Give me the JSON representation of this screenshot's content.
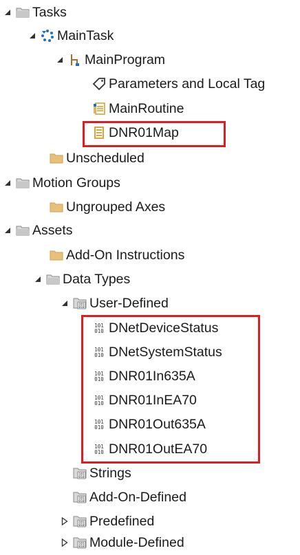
{
  "tree": {
    "tasks": {
      "label": "Tasks",
      "icon": "folder-open-icon"
    },
    "main_task": {
      "label": "MainTask",
      "icon": "continuous-task-icon"
    },
    "main_program": {
      "label": "MainProgram",
      "icon": "program-icon"
    },
    "parameters": {
      "label": "Parameters and Local Tag",
      "icon": "tag-icon"
    },
    "main_routine": {
      "label": "MainRoutine",
      "icon": "ladder-routine-icon"
    },
    "dnr01map": {
      "label": "DNR01Map",
      "icon": "routine-icon"
    },
    "unscheduled": {
      "label": "Unscheduled",
      "icon": "folder-icon"
    },
    "motion_groups": {
      "label": "Motion Groups",
      "icon": "folder-open-icon"
    },
    "ungrouped_axes": {
      "label": "Ungrouped Axes",
      "icon": "folder-icon"
    },
    "assets": {
      "label": "Assets",
      "icon": "folder-open-icon"
    },
    "add_on_instructions": {
      "label": "Add-On Instructions",
      "icon": "folder-icon"
    },
    "data_types": {
      "label": "Data Types",
      "icon": "folder-open-icon"
    },
    "user_defined": {
      "label": "User-Defined",
      "icon": "datatype-folder-icon"
    },
    "udts": [
      {
        "label": "DNetDeviceStatus",
        "icon": "binary-datatype-icon"
      },
      {
        "label": "DNetSystemStatus",
        "icon": "binary-datatype-icon"
      },
      {
        "label": "DNR01In635A",
        "icon": "binary-datatype-icon"
      },
      {
        "label": "DNR01InEA70",
        "icon": "binary-datatype-icon"
      },
      {
        "label": "DNR01Out635A",
        "icon": "binary-datatype-icon"
      },
      {
        "label": "DNR01OutEA70",
        "icon": "binary-datatype-icon"
      }
    ],
    "strings": {
      "label": "Strings",
      "icon": "datatype-folder-icon"
    },
    "add_on_defined": {
      "label": "Add-On-Defined",
      "icon": "datatype-folder-icon"
    },
    "predefined": {
      "label": "Predefined",
      "icon": "datatype-folder-icon"
    },
    "module_defined": {
      "label": "Module-Defined",
      "icon": "datatype-folder-icon"
    }
  },
  "colors": {
    "highlight_border": "#e11b22",
    "folder": "#e9c07a",
    "task_blue": "#1f6fc5",
    "text": "#1a1a1a"
  }
}
